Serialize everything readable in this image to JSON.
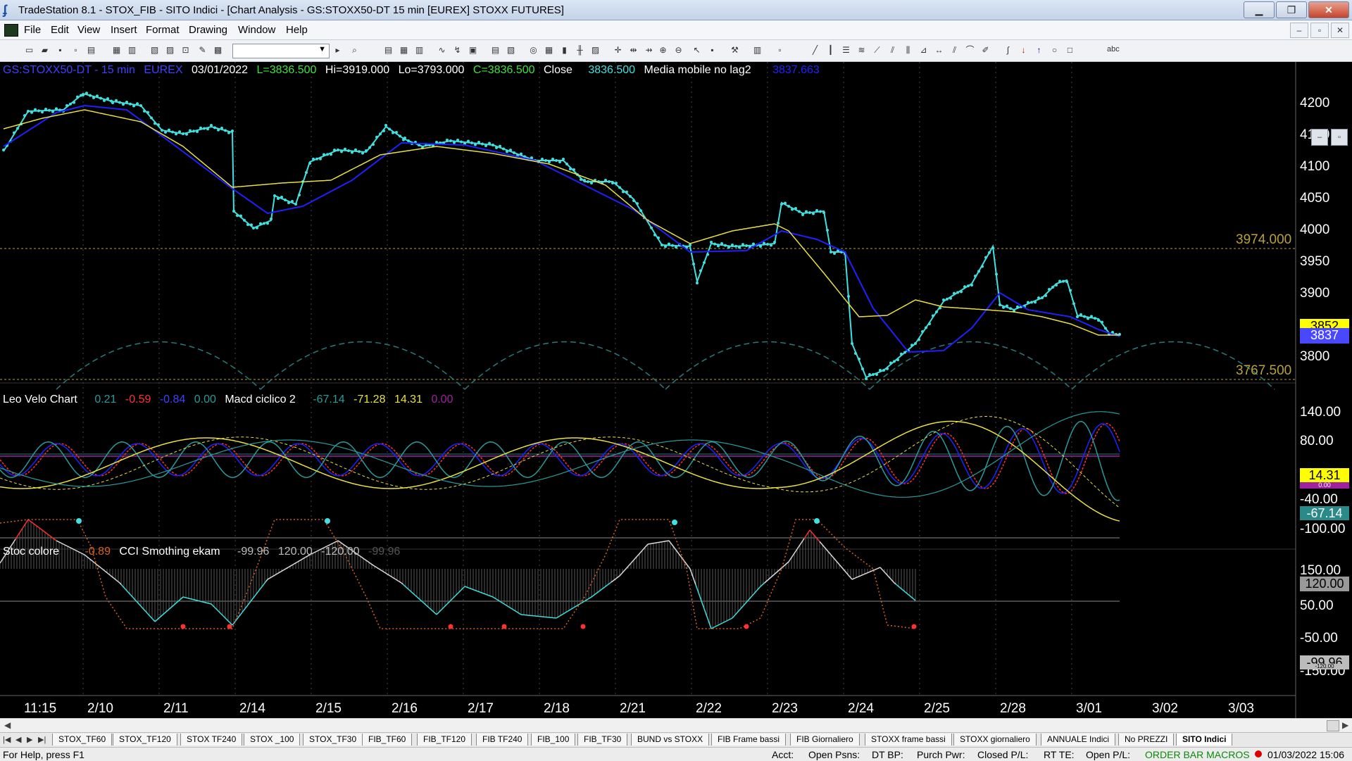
{
  "window": {
    "title": "TradeStation 8.1 - STOX_FIB - SITO Indici - [Chart Analysis - GS:STOXX50-DT  15 min  [EUREX] STOXX FUTURES]",
    "minimize": "▁",
    "restore": "❐",
    "close": "✕"
  },
  "menu": {
    "items": [
      "File",
      "Edit",
      "View",
      "Insert",
      "Format",
      "Drawing",
      "Window",
      "Help"
    ],
    "mdi_min": "‒",
    "mdi_restore": "▫",
    "mdi_close": "✕"
  },
  "toolbar": {
    "combo_arrow": "▼",
    "abc_label": "abc"
  },
  "chart": {
    "header_price": {
      "symbol": "GS:STOXX50-DT - 15 min",
      "exchange": "EUREX",
      "date": "03/01/2022",
      "last": "L=3836.500",
      "high": "Hi=3919.000",
      "low": "Lo=3793.000",
      "close": "C=3836.500",
      "close_label": "Close",
      "close_value": "3836.500",
      "ma_label": "Media mobile no lag2",
      "ma_value": "3837.663"
    },
    "header_macd": {
      "name1": "Leo Velo Chart",
      "v1": "0.21",
      "v2": "-0.59",
      "v3": "-0.84",
      "v4": "0.00",
      "name2": "Macd ciclico 2",
      "v5": "-67.14",
      "v6": "-71.28",
      "v7": "14.31",
      "v8": "0.00"
    },
    "header_stoc": {
      "name1": "Stoc colore",
      "v1": "-0.89",
      "name2": "CCI Smothing ekam",
      "v2": "-99.96",
      "v3": "120.00",
      "v4": "-120.00",
      "v5": "-99.96"
    },
    "price_axis": [
      "4200",
      "4150",
      "4100",
      "4050",
      "4000",
      "3950",
      "3900",
      "3800"
    ],
    "macd_axis": [
      "140.00",
      "80.00",
      "-40.00",
      "-100.00"
    ],
    "stoc_axis": [
      "150.00",
      "50.00",
      "-50.00",
      "-150.00"
    ],
    "price_tags": {
      "t1": "3852",
      "t2": "3837"
    },
    "macd_tags": {
      "t1": "14.31",
      "t2": "0.00",
      "t3": "-67.14"
    },
    "stoc_tags": {
      "t1": "120.00",
      "t2": "-99.96",
      "t3": "-120.00"
    },
    "levels": {
      "upper": "3974.000",
      "lower": "3767.500"
    },
    "dates": [
      "11:15",
      "2/10",
      "2/11",
      "2/14",
      "2/15",
      "2/16",
      "2/17",
      "2/18",
      "2/21",
      "2/22",
      "2/23",
      "2/24",
      "2/25",
      "2/28",
      "3/01",
      "3/02",
      "3/03"
    ],
    "colors": {
      "blue": "#2020ff",
      "yellow": "#e8e040",
      "cyan": "#40e0e0",
      "teal": "#2a8a8a",
      "red": "#ff3030",
      "level": "#b8a13a"
    }
  },
  "tabs": {
    "nav": [
      "|◀",
      "◀",
      "▶",
      "▶|"
    ],
    "items": [
      "STOX_TF60",
      "STOX_TF120",
      "STOX TF240",
      "STOX _100",
      "STOX_TF30",
      "FIB_TF60",
      "FIB_TF120",
      "FIB TF240",
      "FIB_100",
      "FIB_TF30",
      "BUND vs STOXX",
      "FIB Frame bassi",
      "FIB Giornaliero",
      "STOXX frame bassi",
      "STOXX giornaliero",
      "ANNUALE Indici",
      "No PREZZI",
      "SITO Indici"
    ]
  },
  "status": {
    "help": "For Help, press F1",
    "acct": "Acct:",
    "open_psns": "Open Psns:",
    "dt_bp": "DT BP:",
    "purch_pwr": "Purch Pwr:",
    "closed_pl": "Closed P/L:",
    "rt_te": "RT TE:",
    "open_pl": "Open P/L:",
    "macros": "ORDER BAR  MACROS",
    "datetime": "01/03/2022 15:06"
  }
}
